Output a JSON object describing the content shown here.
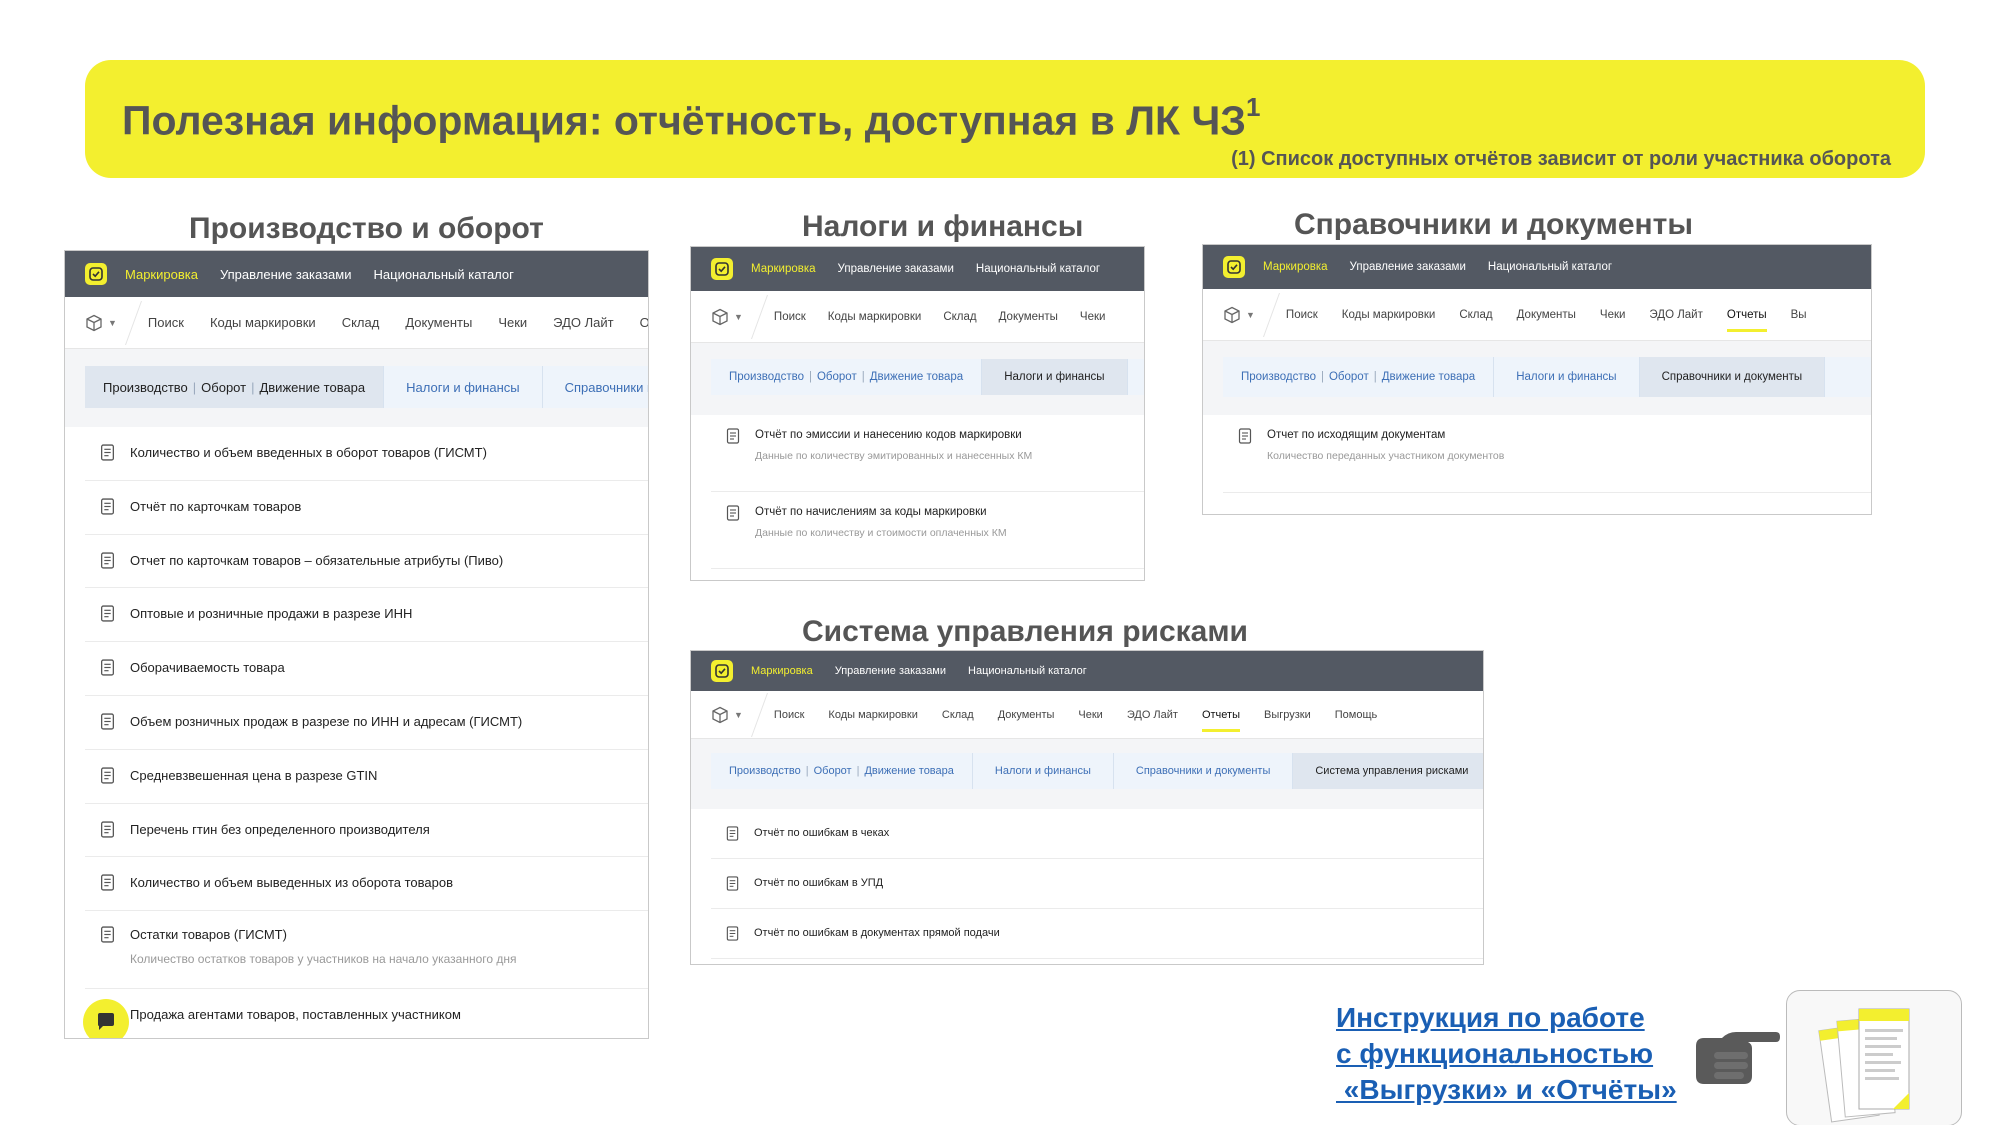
{
  "banner": {
    "title": "Полезная информация: отчётность, доступная в ЛК ЧЗ",
    "title_sup": "1",
    "note": "(1) Список доступных отчётов зависит от роли участника оборота"
  },
  "colors": {
    "accent_yellow": "#f3ef2f",
    "topbar": "#535963",
    "link": "#1a5fb4",
    "tab_link": "#3d6fb6"
  },
  "sections": {
    "production": {
      "title": "Производство и оборот",
      "top_nav": [
        "Маркировка",
        "Управление заказами",
        "Национальный каталог"
      ],
      "nav": [
        "Поиск",
        "Коды маркировки",
        "Склад",
        "Документы",
        "Чеки",
        "ЭДО Лайт",
        "Отч"
      ],
      "tab_parts": [
        "Производство",
        "Оборот",
        "Движение товара"
      ],
      "tabs": [
        "Налоги и финансы",
        "Справочники и доку"
      ],
      "rows": [
        {
          "title": "Количество и объем введенных в оборот товаров (ГИСМТ)"
        },
        {
          "title": "Отчёт по карточкам товаров"
        },
        {
          "title": "Отчет по карточкам товаров – обязательные атрибуты (Пиво)"
        },
        {
          "title": "Оптовые и розничные продажи в разрезе ИНН"
        },
        {
          "title": "Оборачиваемость товара"
        },
        {
          "title": "Объем розничных продаж в разрезе по ИНН и адресам (ГИСМТ)"
        },
        {
          "title": "Средневзвешенная цена в разрезе GTIN"
        },
        {
          "title": "Перечень гтин без определенного производителя"
        },
        {
          "title": "Количество и объем выведенных из оборота товаров"
        },
        {
          "title": "Остатки товаров (ГИСМТ)",
          "subtitle": "Количество остатков товаров у участников на начало указанного дня"
        },
        {
          "title": "Продажа агентами товаров, поставленных участником"
        }
      ]
    },
    "taxes": {
      "title": "Налоги и финансы",
      "top_nav": [
        "Маркировка",
        "Управление заказами",
        "Национальный каталог"
      ],
      "nav": [
        "Поиск",
        "Коды маркировки",
        "Склад",
        "Документы",
        "Чеки"
      ],
      "tab_parts": [
        "Производство",
        "Оборот",
        "Движение товара"
      ],
      "tabs": [
        "Налоги и финансы"
      ],
      "rows": [
        {
          "title": "Отчёт по эмиссии и нанесению кодов маркировки",
          "subtitle": "Данные по количеству эмитированных и нанесенных КМ"
        },
        {
          "title": "Отчёт по начислениям за коды маркировки",
          "subtitle": "Данные по количеству и стоимости оплаченных КМ"
        }
      ]
    },
    "refs": {
      "title": "Справочники и документы",
      "top_nav": [
        "Маркировка",
        "Управление заказами",
        "Национальный каталог"
      ],
      "nav": [
        "Поиск",
        "Коды маркировки",
        "Склад",
        "Документы",
        "Чеки",
        "ЭДО Лайт",
        "Отчеты",
        "Вы"
      ],
      "tab_parts": [
        "Производство",
        "Оборот",
        "Движение товара"
      ],
      "tabs": [
        "Налоги и финансы",
        "Справочники и документы"
      ],
      "rows": [
        {
          "title": "Отчет по исходящим документам",
          "subtitle": "Количество переданных участником документов"
        }
      ]
    },
    "risks": {
      "title": "Система управления рисками",
      "top_nav": [
        "Маркировка",
        "Управление заказами",
        "Национальный каталог"
      ],
      "nav": [
        "Поиск",
        "Коды маркировки",
        "Склад",
        "Документы",
        "Чеки",
        "ЭДО Лайт",
        "Отчеты",
        "Выгрузки",
        "Помощь"
      ],
      "tab_parts": [
        "Производство",
        "Оборот",
        "Движение товара"
      ],
      "tabs": [
        "Налоги и финансы",
        "Справочники и документы",
        "Система управления рисками"
      ],
      "rows": [
        {
          "title": "Отчёт по ошибкам в чеках"
        },
        {
          "title": "Отчёт по ошибкам в УПД"
        },
        {
          "title": "Отчёт по ошибкам в документах прямой подачи"
        }
      ]
    }
  },
  "instruction_link": {
    "lines": [
      "Инструкция по работе",
      "с функциональностью",
      " «Выгрузки» и «Отчёты»"
    ],
    "hand_icon": "pointing-hand-icon",
    "thumbnail_icon": "document-thumbnail-icon"
  }
}
